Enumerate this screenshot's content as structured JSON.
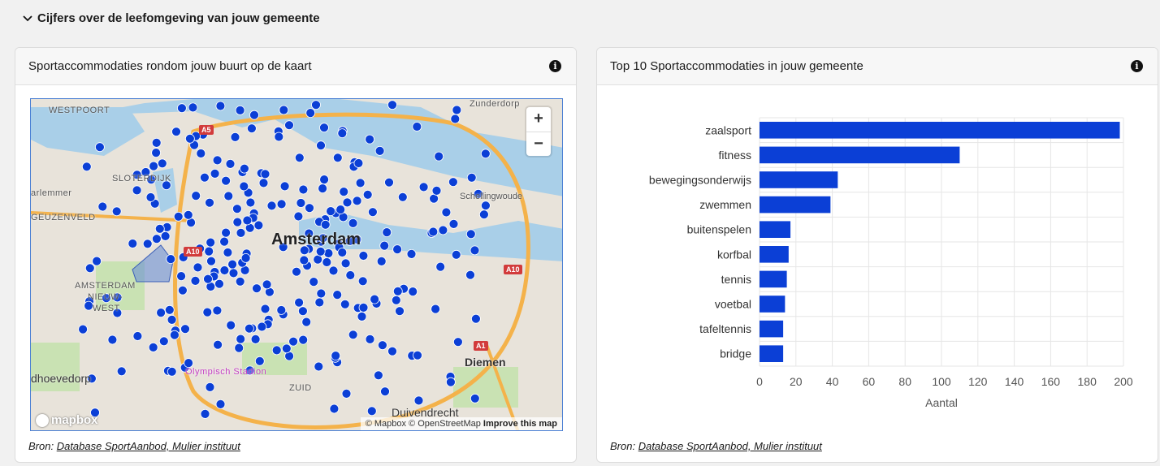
{
  "section": {
    "title": "Cijfers over de leefomgeving van jouw gemeente"
  },
  "map_card": {
    "title": "Sportaccommodaties rondom jouw buurt op de kaart",
    "source_prefix": "Bron:",
    "source_link": "Database SportAanbod, Mulier instituut",
    "map": {
      "zoom_in": "+",
      "zoom_out": "−",
      "logo": "mapbox",
      "attribution": "© Mapbox © OpenStreetMap",
      "improve": "Improve this map",
      "labels": {
        "westpoort": "WESTPOORT",
        "sloterdijk": "SLOTERDIJK",
        "amsterdam_label": "Amsterdam",
        "schellingwoude": "Schellingwoude",
        "diemen": "Diemen",
        "ams_nieuw_west_1": "AMSTERDAM",
        "ams_nieuw_west_2": "NIEUW-",
        "ams_nieuw_west_3": "WEST",
        "hoofddorp": "dhoevedorp",
        "duivendrecht": "Duivendrecht",
        "zunderdorp": "Zunderdorp",
        "geuzenveld": "GEUZENVELD",
        "halfweg": "arlemmer",
        "olympisch": "Olympisch Stadion",
        "zuid": "ZUID",
        "a5": "A5",
        "a10_w": "A10",
        "a10_e": "A10",
        "a1": "A1"
      },
      "dot_color": "#0b3fd6"
    }
  },
  "chart_card": {
    "title": "Top 10 Sportaccommodaties in jouw gemeente",
    "source_prefix": "Bron:",
    "source_link": "Database SportAanbod, Mulier instituut"
  },
  "chart_data": {
    "type": "bar",
    "orientation": "horizontal",
    "categories": [
      "zaalsport",
      "fitness",
      "bewegingsonderwijs",
      "zwemmen",
      "buitenspelen",
      "korfbal",
      "tennis",
      "voetbal",
      "tafeltennis",
      "bridge"
    ],
    "values": [
      198,
      110,
      43,
      39,
      17,
      16,
      15,
      14,
      13,
      13
    ],
    "xlabel": "Aantal",
    "ylabel": "",
    "xlim": [
      0,
      200
    ],
    "xticks": [
      0,
      20,
      40,
      60,
      80,
      100,
      120,
      140,
      160,
      180,
      200
    ],
    "bar_color": "#0b3fd6",
    "grid": true
  }
}
